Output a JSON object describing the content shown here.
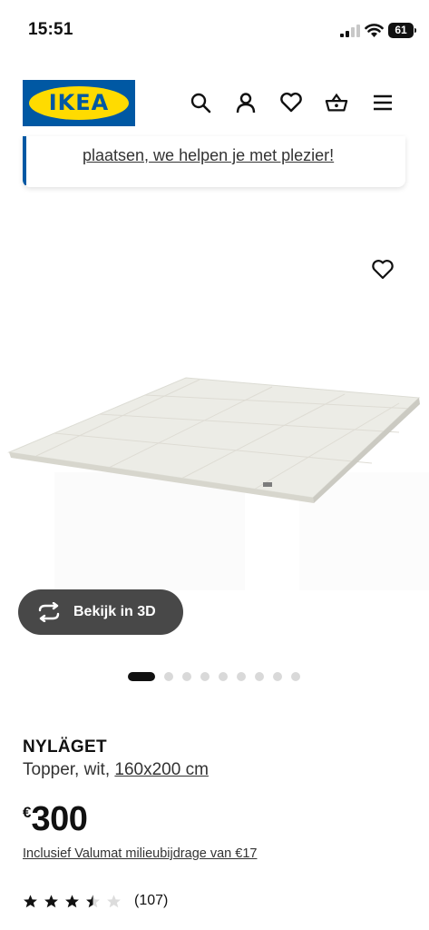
{
  "status_bar": {
    "time": "15:51",
    "battery": "61"
  },
  "header": {
    "logo_text": "IKEA",
    "icons": [
      "search-icon",
      "profile-icon",
      "heart-icon",
      "basket-icon",
      "menu-icon"
    ]
  },
  "banner": {
    "text": "plaatsen, we helpen je met plezier!"
  },
  "gallery": {
    "view_3d_label": "Bekijk in 3D",
    "dots_total": 9,
    "active_dot": 1
  },
  "product": {
    "name": "NYLÄGET",
    "description_prefix": "Topper, wit,",
    "size_link": "160x200 cm",
    "currency": "€",
    "price": "300",
    "eco_fee": "Inclusief Valumat milieubijdrage van €17",
    "rating": 3.5,
    "rating_max": 5,
    "review_count": "(107)"
  },
  "colors": {
    "ikea_blue": "#0058a3",
    "ikea_yellow": "#ffdb00",
    "button_dark": "#484848"
  }
}
